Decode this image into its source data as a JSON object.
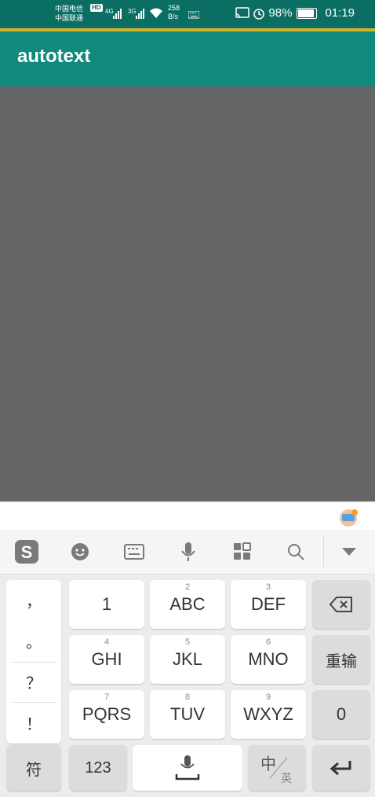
{
  "status_bar": {
    "carrier_1": "中国电信",
    "carrier_2": "中国联通",
    "hd_badge": "HD",
    "net_1": "4G",
    "net_2": "3G",
    "speed_value": "258",
    "speed_unit": "B/s",
    "battery_percent": "98%",
    "time": "01:19"
  },
  "app_bar": {
    "title": "autotext"
  },
  "keyboard": {
    "toolbar": [
      "sogou-logo-icon",
      "emoji-icon",
      "keyboard-icon",
      "microphone-icon",
      "clipboard-grid-icon",
      "search-icon",
      "collapse-keyboard-icon"
    ],
    "punctuation": [
      "，",
      "。",
      "？",
      "！"
    ],
    "keys": {
      "k1": {
        "main": "1"
      },
      "k2": {
        "main": "ABC",
        "sub": "2"
      },
      "k3": {
        "main": "DEF",
        "sub": "3"
      },
      "k4": {
        "main": "GHI",
        "sub": "4"
      },
      "k5": {
        "main": "JKL",
        "sub": "5"
      },
      "k6": {
        "main": "MNO",
        "sub": "6"
      },
      "k7": {
        "main": "PQRS",
        "sub": "7"
      },
      "k8": {
        "main": "TUV",
        "sub": "8"
      },
      "k9": {
        "main": "WXYZ",
        "sub": "9"
      },
      "reenter": "重输",
      "zero": "0",
      "symbol": "符",
      "num": "123",
      "lang_main": "中",
      "lang_sub": "英"
    }
  }
}
